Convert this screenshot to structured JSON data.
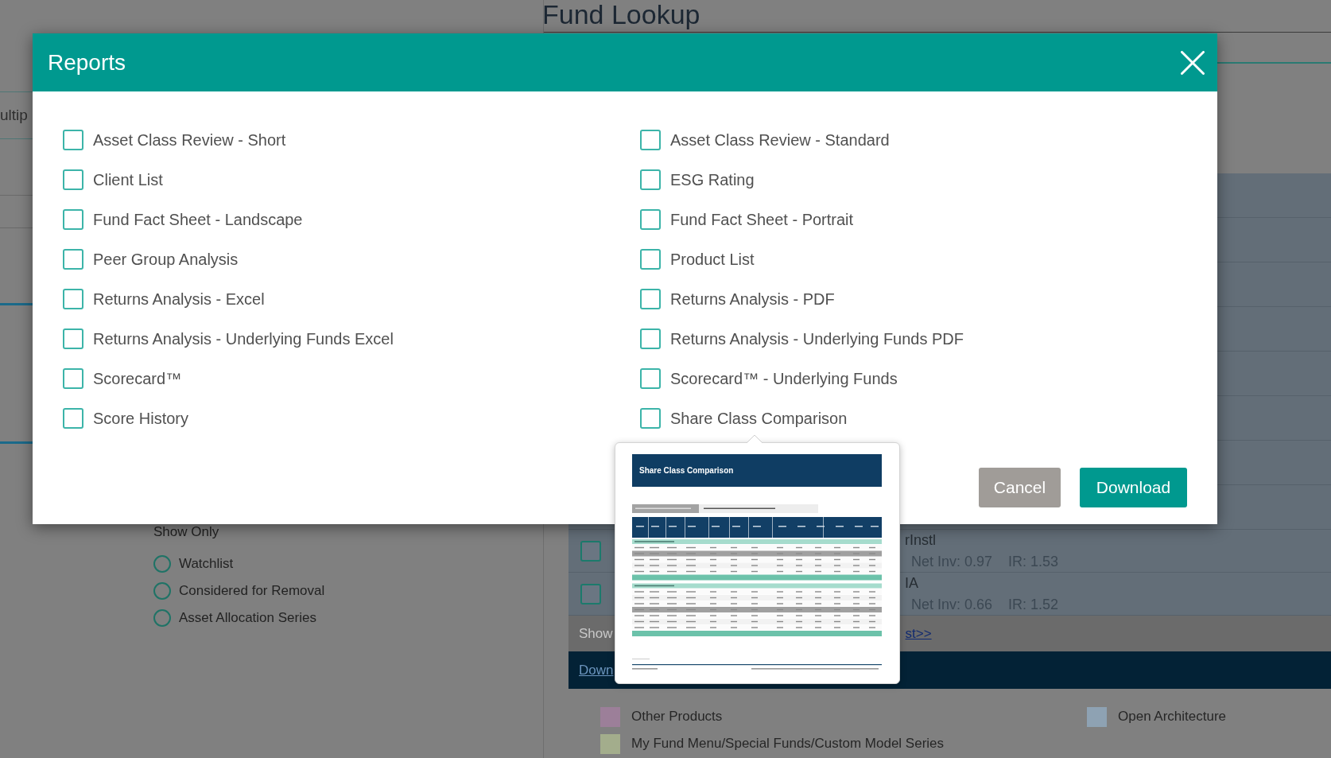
{
  "background": {
    "page_title": "Fund Lookup",
    "field": {
      "value": "ultip"
    },
    "show_only": {
      "label": "Show Only",
      "options": [
        {
          "label": "Watchlist",
          "selected": false
        },
        {
          "label": "Considered for Removal",
          "selected": false
        },
        {
          "label": "Asset Allocation Series",
          "selected": false
        }
      ]
    },
    "fund_rows": [
      {
        "checked": false,
        "name": "rInstl",
        "net_inv": "Net Inv: 0.97",
        "ir": "IR: 1.53"
      },
      {
        "checked": false,
        "name": "IA",
        "net_inv": "Net Inv: 0.66",
        "ir": "IR: 1.52"
      }
    ],
    "show_bar": {
      "label": "Show",
      "link": "st>>"
    },
    "download_bar": {
      "link": "Down"
    },
    "legend": [
      {
        "label": "Other Products",
        "color": "#9c7f99"
      },
      {
        "label": "Open Architecture",
        "color": "#8ea2b3"
      },
      {
        "label": "My Fund Menu/Special Funds/Custom Model Series",
        "color": "#a3ad8c"
      }
    ]
  },
  "dialog": {
    "title": "Reports",
    "reports": [
      {
        "label": "Asset Class Review - Short",
        "checked": false
      },
      {
        "label": "Asset Class Review - Standard",
        "checked": false
      },
      {
        "label": "Client List",
        "checked": false
      },
      {
        "label": "ESG Rating",
        "checked": false
      },
      {
        "label": "Fund Fact Sheet - Landscape",
        "checked": false
      },
      {
        "label": "Fund Fact Sheet - Portrait",
        "checked": false
      },
      {
        "label": "Peer Group Analysis",
        "checked": false
      },
      {
        "label": "Product List",
        "checked": false
      },
      {
        "label": "Returns Analysis - Excel",
        "checked": false
      },
      {
        "label": "Returns Analysis - PDF",
        "checked": false
      },
      {
        "label": "Returns Analysis - Underlying Funds Excel",
        "checked": false
      },
      {
        "label": "Returns Analysis - Underlying Funds PDF",
        "checked": false
      },
      {
        "label": "Scorecard™",
        "checked": false
      },
      {
        "label": "Scorecard™ - Underlying Funds",
        "checked": false
      },
      {
        "label": "Score History",
        "checked": false
      },
      {
        "label": "Share Class Comparison",
        "checked": false
      }
    ],
    "buttons": [
      {
        "label": "Cancel",
        "kind": "secondary"
      },
      {
        "label": "Download",
        "kind": "primary"
      }
    ]
  },
  "preview": {
    "document_title": "Share Class Comparison"
  }
}
